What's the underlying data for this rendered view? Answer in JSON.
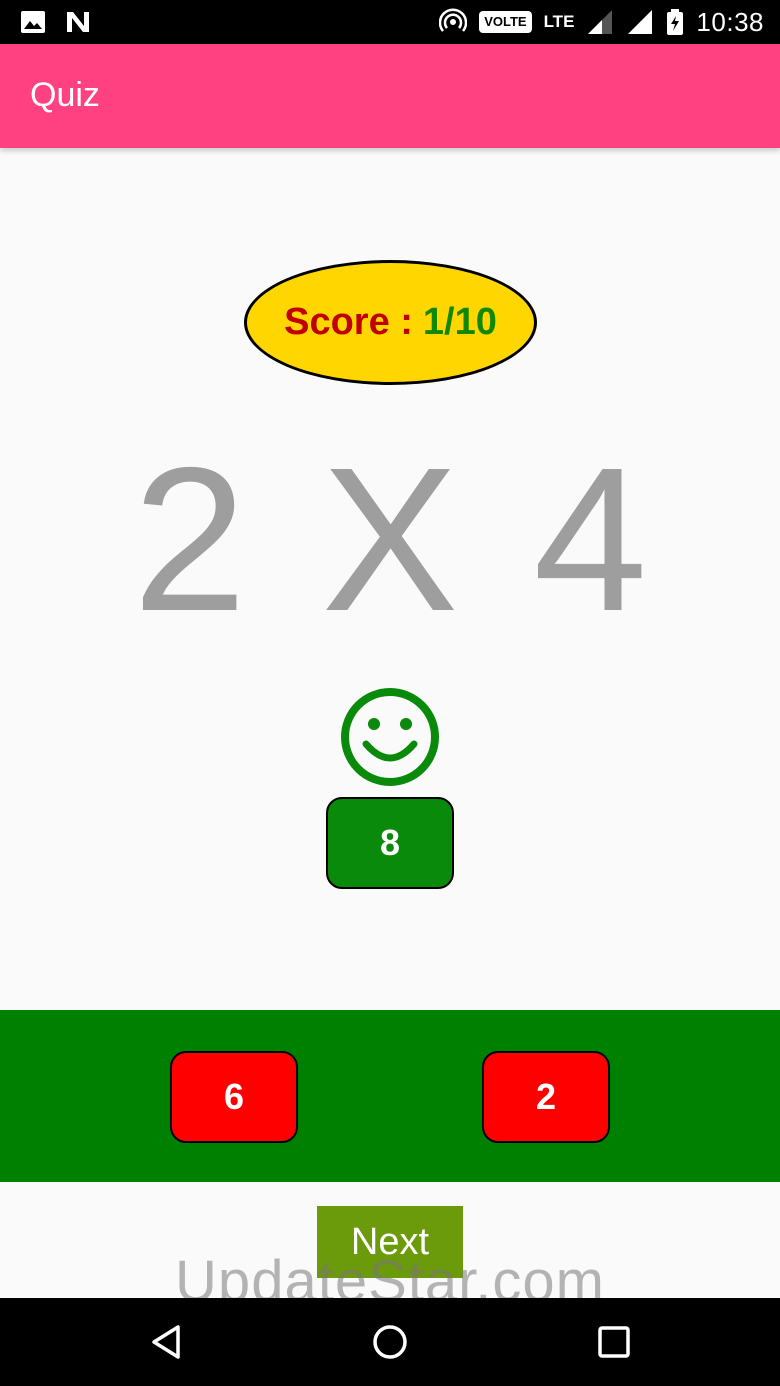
{
  "status_bar": {
    "time": "10:38",
    "volte": "VOLTE",
    "lte": "LTE",
    "icons": [
      "image-icon",
      "n-app-icon",
      "hotspot-icon",
      "signal-icon",
      "wifi-icon",
      "battery-icon"
    ]
  },
  "app_bar": {
    "title": "Quiz",
    "color": "#ff4081"
  },
  "score": {
    "label": "Score :",
    "value": "1/10"
  },
  "question": {
    "text": "2 X 4"
  },
  "feedback": {
    "icon": "smiley-face-icon",
    "color": "#0a8a0a"
  },
  "answers": {
    "correct": "8",
    "options": [
      "6",
      "2"
    ]
  },
  "next_button": {
    "label": "Next"
  },
  "watermark": "UpdateStar.com",
  "nav_bar": {
    "icons": [
      "back-icon",
      "home-icon",
      "recents-icon"
    ]
  }
}
